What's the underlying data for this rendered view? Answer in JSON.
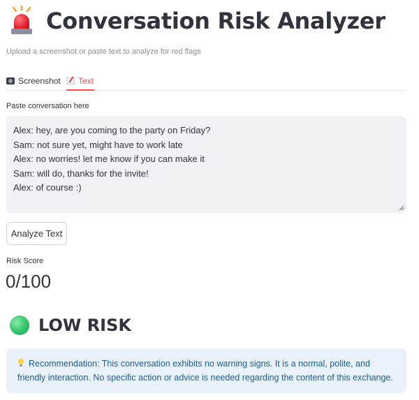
{
  "header": {
    "title": "Conversation Risk Analyzer",
    "icon": "police-siren-icon"
  },
  "subtitle": "Upload a screenshot or paste text to analyze for red flags",
  "tabs": [
    {
      "label": "Screenshot",
      "icon": "camera-icon",
      "active": false
    },
    {
      "label": "Text",
      "icon": "memo-icon",
      "active": true
    }
  ],
  "input": {
    "label": "Paste conversation here",
    "value": "Alex: hey, are you coming to the party on Friday?\nSam: not sure yet, might have to work late\nAlex: no worries! let me know if you can make it\nSam: will do, thanks for the invite!\nAlex: of course :)"
  },
  "actions": {
    "analyze_label": "Analyze Text"
  },
  "metric": {
    "label": "Risk Score",
    "value": "0/100"
  },
  "risk": {
    "level": "LOW RISK",
    "icon": "green-circle-icon"
  },
  "recommendation": {
    "icon": "light-bulb-icon",
    "text": "Recommendation: This conversation exhibits no warning signs. It is a normal, polite, and friendly interaction. No specific action or advice is needed regarding the content of this exchange."
  },
  "colors": {
    "accent": "#ff4b4b",
    "info_bg": "#e9f1fd",
    "info_text": "#1f5a94",
    "input_bg": "#f0f2f6"
  }
}
